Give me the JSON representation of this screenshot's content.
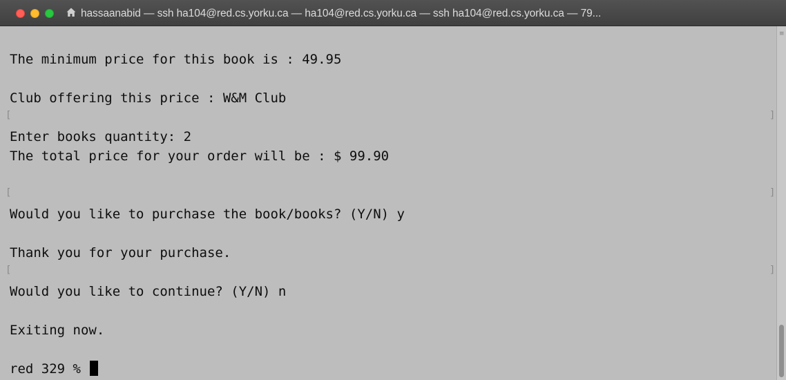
{
  "window": {
    "title": "hassaanabid — ssh ha104@red.cs.yorku.ca — ha104@red.cs.yorku.ca — ssh ha104@red.cs.yorku.ca — 79..."
  },
  "terminal": {
    "lines": [
      "The minimum price for this book is : 49.95",
      "Club offering this price : W&M Club",
      "Enter books quantity: 2",
      "The total price for your order will be : $ 99.90",
      "Would you like to purchase the book/books? (Y/N) y",
      "Thank you for your purchase.",
      "Would you like to continue? (Y/N) n",
      "Exiting now."
    ],
    "prompt": "red 329 % ",
    "bracket_left": "[",
    "bracket_right": "]"
  },
  "colors": {
    "background": "#bdbdbd",
    "text": "#0e0e0e",
    "titlebar": "#444444",
    "close": "#ff5f57",
    "minimize": "#febc2e",
    "maximize": "#28c840"
  },
  "icons": {
    "title_icon": "home-icon"
  }
}
